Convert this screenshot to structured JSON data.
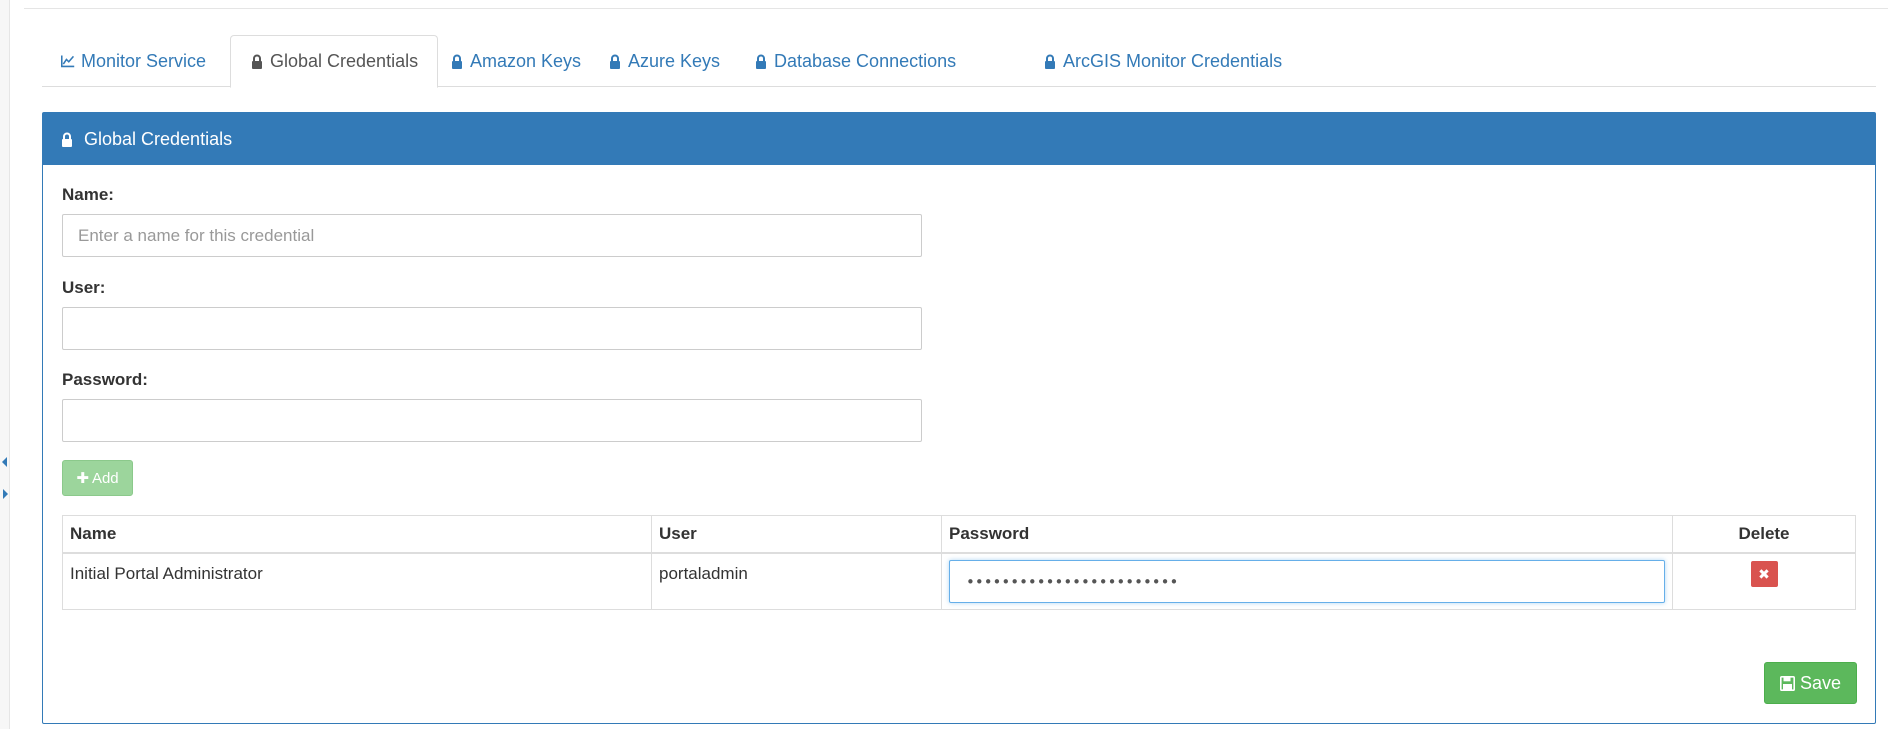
{
  "tabs": [
    {
      "label": "Monitor Service",
      "icon": "line-chart-icon",
      "active": false
    },
    {
      "label": "Global Credentials",
      "icon": "lock-icon",
      "active": true
    },
    {
      "label": "Amazon Keys",
      "icon": "lock-icon",
      "active": false
    },
    {
      "label": "Azure Keys",
      "icon": "lock-icon",
      "active": false
    },
    {
      "label": "Database Connections",
      "icon": "lock-icon",
      "active": false
    },
    {
      "label": "ArcGIS Monitor Credentials",
      "icon": "lock-icon",
      "active": false
    }
  ],
  "panel": {
    "title": "Global Credentials",
    "icon": "lock-icon",
    "heading_color": "#337ab7"
  },
  "form": {
    "name_label": "Name:",
    "name_placeholder": "Enter a name for this credential",
    "name_value": "",
    "user_label": "User:",
    "user_value": "",
    "password_label": "Password:",
    "password_value": "",
    "add_label": "Add"
  },
  "table": {
    "columns": [
      "Name",
      "User",
      "Password",
      "Delete"
    ],
    "rows": [
      {
        "name": "Initial Portal Administrator",
        "user": "portaladmin",
        "password": "••••••••••••••••••••••••"
      }
    ]
  },
  "save_label": "Save",
  "colors": {
    "primary": "#337ab7",
    "success": "#5cb85c",
    "success_disabled": "#9cd59c",
    "danger": "#d9534f"
  }
}
